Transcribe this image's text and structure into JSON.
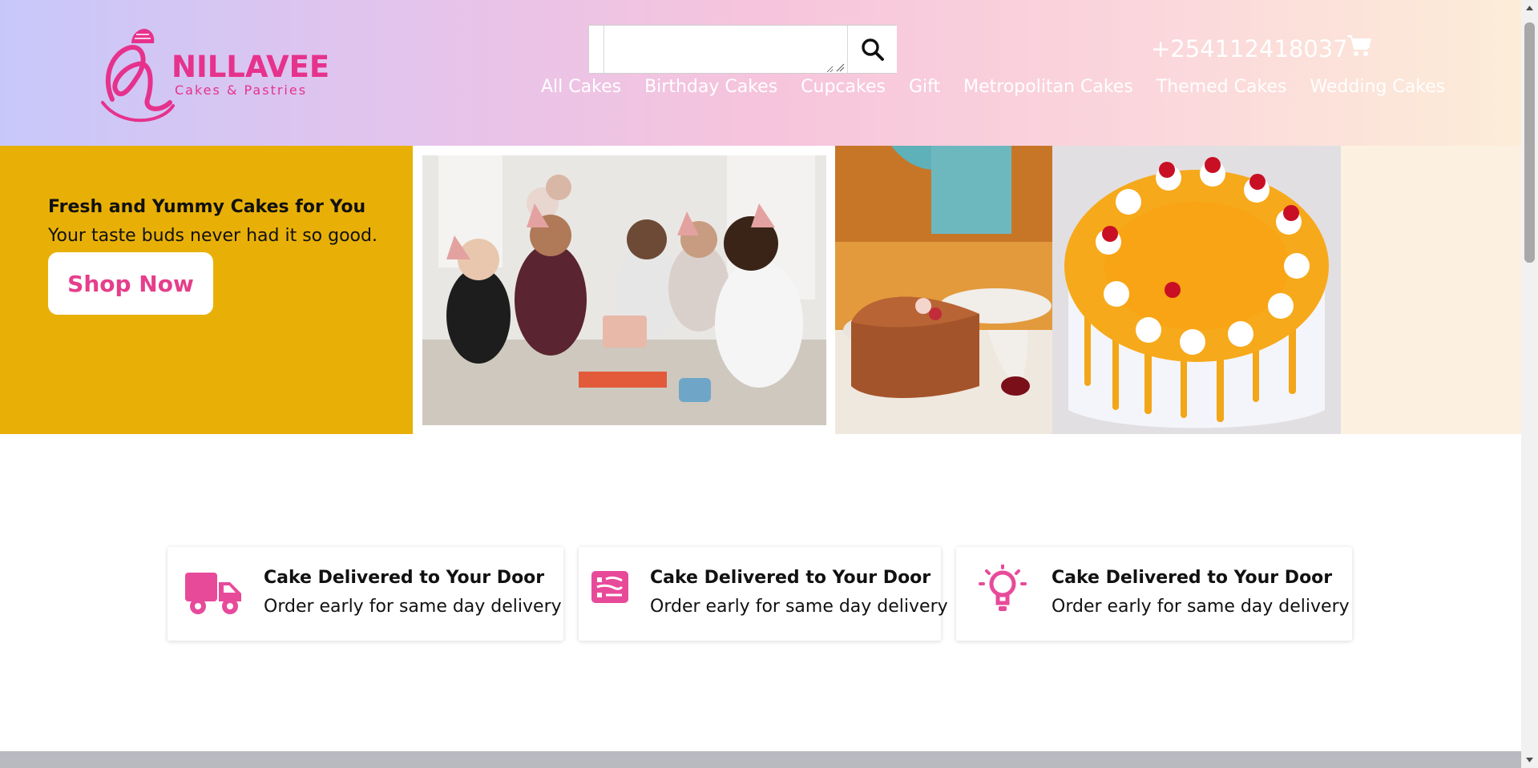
{
  "brand": {
    "name": "NILLAVEE",
    "tagline": "Cakes & Pastries",
    "color": "#e6328c"
  },
  "header": {
    "search": {
      "value": "",
      "placeholder": ""
    },
    "phone": "+254112418037",
    "nav": [
      "All Cakes",
      "Birthday Cakes",
      "Cupcakes",
      "Gift",
      "Metropolitan Cakes",
      "Themed Cakes",
      "Wedding Cakes"
    ]
  },
  "hero": {
    "title": "Fresh and Yummy Cakes for You",
    "subtitle": "Your taste buds never had it so good.",
    "cta": "Shop Now",
    "accent": "#e8b007"
  },
  "features": [
    {
      "icon": "truck-icon",
      "title": "Cake Delivered to Your Door",
      "subtitle": "Order early for same day delivery"
    },
    {
      "icon": "receipt-icon",
      "title": "Cake Delivered to Your Door",
      "subtitle": "Order early for same day delivery"
    },
    {
      "icon": "lightbulb-icon",
      "title": "Cake Delivered to Your Door",
      "subtitle": "Order early for same day delivery"
    }
  ],
  "colors": {
    "pink": "#e63e8b",
    "icon_pink": "#e84a9a"
  }
}
